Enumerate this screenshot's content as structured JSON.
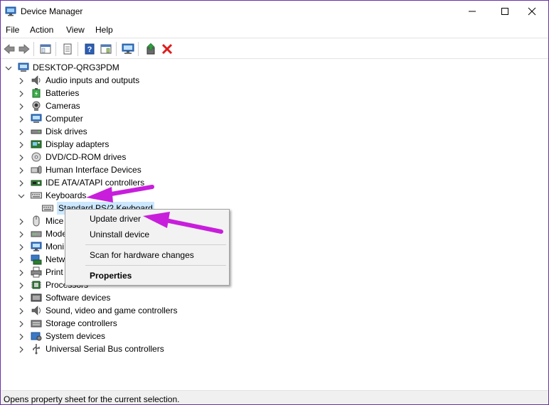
{
  "window": {
    "title": "Device Manager"
  },
  "menu": [
    "File",
    "Action",
    "View",
    "Help"
  ],
  "tree": {
    "root": "DESKTOP-QRG3PDM",
    "categories": [
      "Audio inputs and outputs",
      "Batteries",
      "Cameras",
      "Computer",
      "Disk drives",
      "Display adapters",
      "DVD/CD-ROM drives",
      "Human Interface Devices",
      "IDE ATA/ATAPI controllers",
      "Keyboards",
      "Mice",
      "Mode",
      "Moni",
      "Netw",
      "Print",
      "Processors",
      "Software devices",
      "Sound, video and game controllers",
      "Storage controllers",
      "System devices",
      "Universal Serial Bus controllers"
    ],
    "selected_child": "Standard PS/2 Keyboard"
  },
  "context_menu": {
    "items": [
      "Update driver",
      "Uninstall device",
      "Scan for hardware changes",
      "Properties"
    ]
  },
  "status": {
    "text": "Opens property sheet for the current selection."
  },
  "colors": {
    "accent_arrow": "#c81edc",
    "selection": "#cce8ff",
    "frame": "#6b2fa8"
  }
}
